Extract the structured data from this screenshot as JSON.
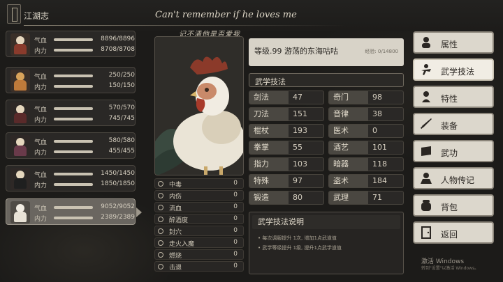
{
  "header": {
    "title": "江湖志",
    "motto_en": "Can't remember if he loves me",
    "motto_cn": "记不清他是否爱我"
  },
  "party": [
    {
      "hp_label": "气血",
      "hp": "8896/8896",
      "mp_label": "内力",
      "mp": "8708/8708",
      "hp_fraction": 1.0,
      "mp_fraction": 1.0,
      "color": "#8a3b2c"
    },
    {
      "hp_label": "气血",
      "hp": "250/250",
      "mp_label": "内力",
      "mp": "150/150",
      "hp_fraction": 1.0,
      "mp_fraction": 1.0,
      "color": "#c07a3a"
    },
    {
      "hp_label": "气血",
      "hp": "570/570",
      "mp_label": "内力",
      "mp": "745/745",
      "hp_fraction": 1.0,
      "mp_fraction": 1.0,
      "color": "#5a2a2a"
    },
    {
      "hp_label": "气血",
      "hp": "580/580",
      "mp_label": "内力",
      "mp": "455/455",
      "hp_fraction": 1.0,
      "mp_fraction": 1.0,
      "color": "#6a3a4a"
    },
    {
      "hp_label": "气血",
      "hp": "1450/1450",
      "mp_label": "内力",
      "mp": "1850/1850",
      "hp_fraction": 1.0,
      "mp_fraction": 1.0,
      "color": "#2e2e2e"
    },
    {
      "hp_label": "气血",
      "hp": "9052/9052",
      "mp_label": "内力",
      "mp": "2389/2389",
      "hp_fraction": 1.0,
      "mp_fraction": 1.0,
      "color": "#3a3a3a"
    }
  ],
  "character": {
    "level_name": "等级.99  游荡的东海咕咕",
    "exp": "经验: 0/14800"
  },
  "status_effects": [
    {
      "label": "中毒",
      "value": "0"
    },
    {
      "label": "内伤",
      "value": "0"
    },
    {
      "label": "流血",
      "value": "0"
    },
    {
      "label": "醉酒度",
      "value": "0"
    },
    {
      "label": "封穴",
      "value": "0"
    },
    {
      "label": "走火入魔",
      "value": "0"
    },
    {
      "label": "燃烧",
      "value": "0"
    },
    {
      "label": "击退",
      "value": "0"
    }
  ],
  "skills_section": {
    "title": "武学技法",
    "rows": [
      {
        "a_label": "剑法",
        "a_val": "47",
        "b_label": "奇门",
        "b_val": "98"
      },
      {
        "a_label": "刀法",
        "a_val": "151",
        "b_label": "音律",
        "b_val": "38"
      },
      {
        "a_label": "棍杖",
        "a_val": "193",
        "b_label": "医术",
        "b_val": "0"
      },
      {
        "a_label": "拳掌",
        "a_val": "55",
        "b_label": "酒艺",
        "b_val": "101"
      },
      {
        "a_label": "指力",
        "a_val": "103",
        "b_label": "暗器",
        "b_val": "118"
      },
      {
        "a_label": "特殊",
        "a_val": "97",
        "b_label": "盗术",
        "b_val": "184"
      },
      {
        "a_label": "锻造",
        "a_val": "80",
        "b_label": "武理",
        "b_val": "71"
      }
    ]
  },
  "description": {
    "title": "武学技法说明",
    "lines": [
      "• 每次调服提升 1次, 增加1点武道值",
      "• 武学等级提升 1级, 提升1点武学道值"
    ]
  },
  "menu": [
    {
      "label": "属性",
      "icon": "person-icon",
      "active": false
    },
    {
      "label": "武学技法",
      "icon": "martial-icon",
      "active": true
    },
    {
      "label": "特性",
      "icon": "trait-icon",
      "active": false
    },
    {
      "label": "装备",
      "icon": "sword-icon",
      "active": false
    },
    {
      "label": "武功",
      "icon": "book-icon",
      "active": false
    },
    {
      "label": "人物传记",
      "icon": "biography-icon",
      "active": false
    },
    {
      "label": "背包",
      "icon": "bag-icon",
      "active": false
    },
    {
      "label": "返回",
      "icon": "return-icon",
      "active": false
    }
  ],
  "watermark": {
    "line1": "激活 Windows",
    "line2": "转到\"设置\"以激活 Windows。"
  }
}
